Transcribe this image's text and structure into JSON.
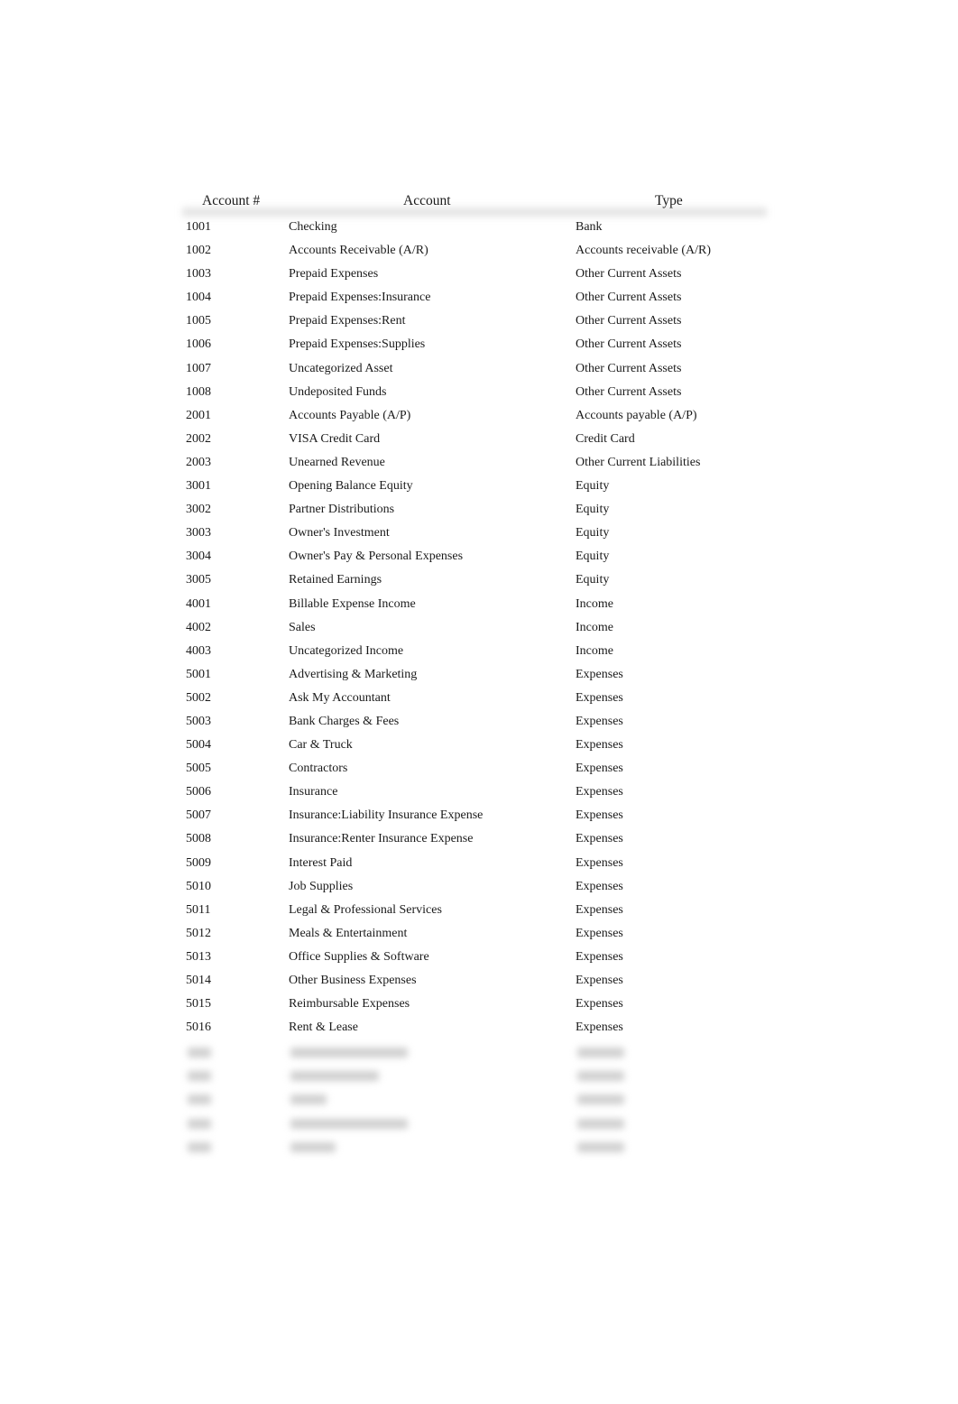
{
  "table": {
    "headers": {
      "number": "Account #",
      "account": "Account",
      "type": "Type"
    },
    "rows": [
      {
        "number": "1001",
        "account": "Checking",
        "type": "Bank"
      },
      {
        "number": "1002",
        "account": "Accounts Receivable (A/R)",
        "type": "Accounts receivable (A/R)"
      },
      {
        "number": "1003",
        "account": "Prepaid Expenses",
        "type": "Other Current Assets"
      },
      {
        "number": "1004",
        "account": "Prepaid Expenses:Insurance",
        "type": "Other Current Assets"
      },
      {
        "number": "1005",
        "account": "Prepaid Expenses:Rent",
        "type": "Other Current Assets"
      },
      {
        "number": "1006",
        "account": "Prepaid Expenses:Supplies",
        "type": "Other Current Assets"
      },
      {
        "number": "1007",
        "account": "Uncategorized Asset",
        "type": "Other Current Assets"
      },
      {
        "number": "1008",
        "account": "Undeposited Funds",
        "type": "Other Current Assets"
      },
      {
        "number": "2001",
        "account": "Accounts Payable (A/P)",
        "type": "Accounts payable (A/P)"
      },
      {
        "number": "2002",
        "account": "VISA Credit Card",
        "type": "Credit Card"
      },
      {
        "number": "2003",
        "account": "Unearned Revenue",
        "type": "Other Current Liabilities"
      },
      {
        "number": "3001",
        "account": "Opening Balance Equity",
        "type": "Equity"
      },
      {
        "number": "3002",
        "account": "Partner Distributions",
        "type": "Equity"
      },
      {
        "number": "3003",
        "account": "Owner's Investment",
        "type": "Equity"
      },
      {
        "number": "3004",
        "account": "Owner's Pay & Personal Expenses",
        "type": "Equity"
      },
      {
        "number": "3005",
        "account": "Retained Earnings",
        "type": "Equity"
      },
      {
        "number": "4001",
        "account": "Billable Expense Income",
        "type": "Income"
      },
      {
        "number": "4002",
        "account": "Sales",
        "type": "Income"
      },
      {
        "number": "4003",
        "account": "Uncategorized Income",
        "type": "Income"
      },
      {
        "number": "5001",
        "account": "Advertising & Marketing",
        "type": "Expenses"
      },
      {
        "number": "5002",
        "account": "Ask My Accountant",
        "type": "Expenses"
      },
      {
        "number": "5003",
        "account": "Bank Charges & Fees",
        "type": "Expenses"
      },
      {
        "number": "5004",
        "account": "Car & Truck",
        "type": "Expenses"
      },
      {
        "number": "5005",
        "account": "Contractors",
        "type": "Expenses"
      },
      {
        "number": "5006",
        "account": "Insurance",
        "type": "Expenses"
      },
      {
        "number": "5007",
        "account": "Insurance:Liability Insurance Expense",
        "type": "Expenses"
      },
      {
        "number": "5008",
        "account": "Insurance:Renter Insurance Expense",
        "type": "Expenses"
      },
      {
        "number": "5009",
        "account": "Interest Paid",
        "type": "Expenses"
      },
      {
        "number": "5010",
        "account": "Job Supplies",
        "type": "Expenses"
      },
      {
        "number": "5011",
        "account": "Legal & Professional Services",
        "type": "Expenses"
      },
      {
        "number": "5012",
        "account": "Meals & Entertainment",
        "type": "Expenses"
      },
      {
        "number": "5013",
        "account": "Office Supplies & Software",
        "type": "Expenses"
      },
      {
        "number": "5014",
        "account": "Other Business Expenses",
        "type": "Expenses"
      },
      {
        "number": "5015",
        "account": "Reimbursable Expenses",
        "type": "Expenses"
      },
      {
        "number": "5016",
        "account": "Rent & Lease",
        "type": "Expenses"
      }
    ],
    "blurred_row_count": 5
  }
}
